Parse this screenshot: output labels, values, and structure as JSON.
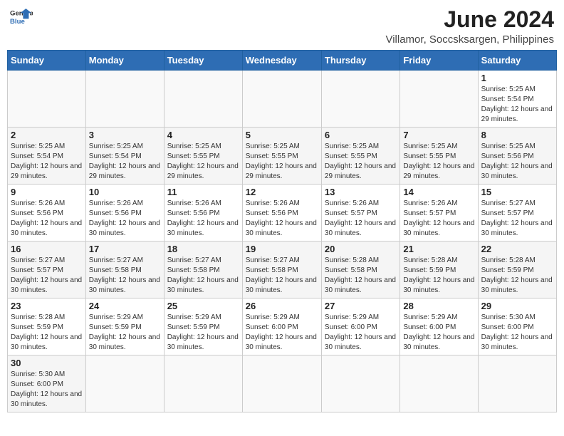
{
  "header": {
    "logo_line1": "General",
    "logo_line2": "Blue",
    "month_year": "June 2024",
    "location": "Villamor, Soccsksargen, Philippines"
  },
  "weekdays": [
    "Sunday",
    "Monday",
    "Tuesday",
    "Wednesday",
    "Thursday",
    "Friday",
    "Saturday"
  ],
  "weeks": [
    [
      {
        "day": "",
        "info": ""
      },
      {
        "day": "",
        "info": ""
      },
      {
        "day": "",
        "info": ""
      },
      {
        "day": "",
        "info": ""
      },
      {
        "day": "",
        "info": ""
      },
      {
        "day": "",
        "info": ""
      },
      {
        "day": "1",
        "info": "Sunrise: 5:25 AM\nSunset: 5:54 PM\nDaylight: 12 hours and 29 minutes."
      }
    ],
    [
      {
        "day": "2",
        "info": "Sunrise: 5:25 AM\nSunset: 5:54 PM\nDaylight: 12 hours and 29 minutes."
      },
      {
        "day": "3",
        "info": "Sunrise: 5:25 AM\nSunset: 5:54 PM\nDaylight: 12 hours and 29 minutes."
      },
      {
        "day": "4",
        "info": "Sunrise: 5:25 AM\nSunset: 5:55 PM\nDaylight: 12 hours and 29 minutes."
      },
      {
        "day": "5",
        "info": "Sunrise: 5:25 AM\nSunset: 5:55 PM\nDaylight: 12 hours and 29 minutes."
      },
      {
        "day": "6",
        "info": "Sunrise: 5:25 AM\nSunset: 5:55 PM\nDaylight: 12 hours and 29 minutes."
      },
      {
        "day": "7",
        "info": "Sunrise: 5:25 AM\nSunset: 5:55 PM\nDaylight: 12 hours and 29 minutes."
      },
      {
        "day": "8",
        "info": "Sunrise: 5:25 AM\nSunset: 5:56 PM\nDaylight: 12 hours and 30 minutes."
      }
    ],
    [
      {
        "day": "9",
        "info": "Sunrise: 5:26 AM\nSunset: 5:56 PM\nDaylight: 12 hours and 30 minutes."
      },
      {
        "day": "10",
        "info": "Sunrise: 5:26 AM\nSunset: 5:56 PM\nDaylight: 12 hours and 30 minutes."
      },
      {
        "day": "11",
        "info": "Sunrise: 5:26 AM\nSunset: 5:56 PM\nDaylight: 12 hours and 30 minutes."
      },
      {
        "day": "12",
        "info": "Sunrise: 5:26 AM\nSunset: 5:56 PM\nDaylight: 12 hours and 30 minutes."
      },
      {
        "day": "13",
        "info": "Sunrise: 5:26 AM\nSunset: 5:57 PM\nDaylight: 12 hours and 30 minutes."
      },
      {
        "day": "14",
        "info": "Sunrise: 5:26 AM\nSunset: 5:57 PM\nDaylight: 12 hours and 30 minutes."
      },
      {
        "day": "15",
        "info": "Sunrise: 5:27 AM\nSunset: 5:57 PM\nDaylight: 12 hours and 30 minutes."
      }
    ],
    [
      {
        "day": "16",
        "info": "Sunrise: 5:27 AM\nSunset: 5:57 PM\nDaylight: 12 hours and 30 minutes."
      },
      {
        "day": "17",
        "info": "Sunrise: 5:27 AM\nSunset: 5:58 PM\nDaylight: 12 hours and 30 minutes."
      },
      {
        "day": "18",
        "info": "Sunrise: 5:27 AM\nSunset: 5:58 PM\nDaylight: 12 hours and 30 minutes."
      },
      {
        "day": "19",
        "info": "Sunrise: 5:27 AM\nSunset: 5:58 PM\nDaylight: 12 hours and 30 minutes."
      },
      {
        "day": "20",
        "info": "Sunrise: 5:28 AM\nSunset: 5:58 PM\nDaylight: 12 hours and 30 minutes."
      },
      {
        "day": "21",
        "info": "Sunrise: 5:28 AM\nSunset: 5:59 PM\nDaylight: 12 hours and 30 minutes."
      },
      {
        "day": "22",
        "info": "Sunrise: 5:28 AM\nSunset: 5:59 PM\nDaylight: 12 hours and 30 minutes."
      }
    ],
    [
      {
        "day": "23",
        "info": "Sunrise: 5:28 AM\nSunset: 5:59 PM\nDaylight: 12 hours and 30 minutes."
      },
      {
        "day": "24",
        "info": "Sunrise: 5:29 AM\nSunset: 5:59 PM\nDaylight: 12 hours and 30 minutes."
      },
      {
        "day": "25",
        "info": "Sunrise: 5:29 AM\nSunset: 5:59 PM\nDaylight: 12 hours and 30 minutes."
      },
      {
        "day": "26",
        "info": "Sunrise: 5:29 AM\nSunset: 6:00 PM\nDaylight: 12 hours and 30 minutes."
      },
      {
        "day": "27",
        "info": "Sunrise: 5:29 AM\nSunset: 6:00 PM\nDaylight: 12 hours and 30 minutes."
      },
      {
        "day": "28",
        "info": "Sunrise: 5:29 AM\nSunset: 6:00 PM\nDaylight: 12 hours and 30 minutes."
      },
      {
        "day": "29",
        "info": "Sunrise: 5:30 AM\nSunset: 6:00 PM\nDaylight: 12 hours and 30 minutes."
      }
    ],
    [
      {
        "day": "30",
        "info": "Sunrise: 5:30 AM\nSunset: 6:00 PM\nDaylight: 12 hours and 30 minutes."
      },
      {
        "day": "",
        "info": ""
      },
      {
        "day": "",
        "info": ""
      },
      {
        "day": "",
        "info": ""
      },
      {
        "day": "",
        "info": ""
      },
      {
        "day": "",
        "info": ""
      },
      {
        "day": "",
        "info": ""
      }
    ]
  ]
}
